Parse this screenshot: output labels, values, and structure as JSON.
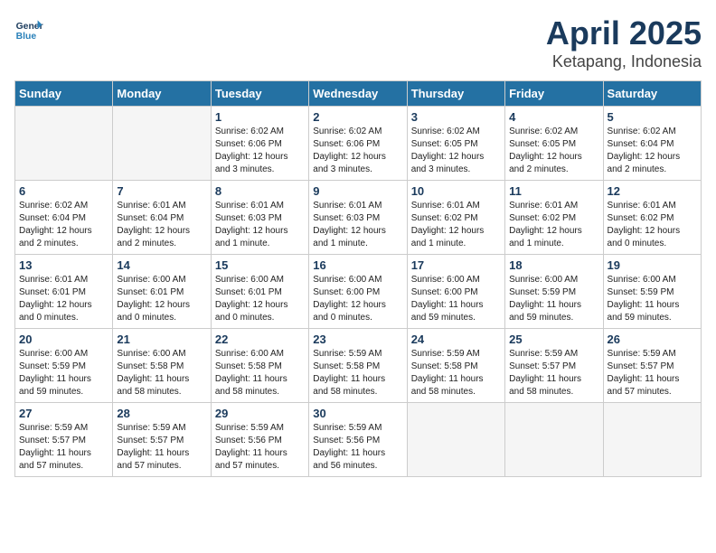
{
  "header": {
    "logo_line1": "General",
    "logo_line2": "Blue",
    "month": "April 2025",
    "location": "Ketapang, Indonesia"
  },
  "weekdays": [
    "Sunday",
    "Monday",
    "Tuesday",
    "Wednesday",
    "Thursday",
    "Friday",
    "Saturday"
  ],
  "weeks": [
    [
      {
        "day": "",
        "info": ""
      },
      {
        "day": "",
        "info": ""
      },
      {
        "day": "1",
        "info": "Sunrise: 6:02 AM\nSunset: 6:06 PM\nDaylight: 12 hours\nand 3 minutes."
      },
      {
        "day": "2",
        "info": "Sunrise: 6:02 AM\nSunset: 6:06 PM\nDaylight: 12 hours\nand 3 minutes."
      },
      {
        "day": "3",
        "info": "Sunrise: 6:02 AM\nSunset: 6:05 PM\nDaylight: 12 hours\nand 3 minutes."
      },
      {
        "day": "4",
        "info": "Sunrise: 6:02 AM\nSunset: 6:05 PM\nDaylight: 12 hours\nand 2 minutes."
      },
      {
        "day": "5",
        "info": "Sunrise: 6:02 AM\nSunset: 6:04 PM\nDaylight: 12 hours\nand 2 minutes."
      }
    ],
    [
      {
        "day": "6",
        "info": "Sunrise: 6:02 AM\nSunset: 6:04 PM\nDaylight: 12 hours\nand 2 minutes."
      },
      {
        "day": "7",
        "info": "Sunrise: 6:01 AM\nSunset: 6:04 PM\nDaylight: 12 hours\nand 2 minutes."
      },
      {
        "day": "8",
        "info": "Sunrise: 6:01 AM\nSunset: 6:03 PM\nDaylight: 12 hours\nand 1 minute."
      },
      {
        "day": "9",
        "info": "Sunrise: 6:01 AM\nSunset: 6:03 PM\nDaylight: 12 hours\nand 1 minute."
      },
      {
        "day": "10",
        "info": "Sunrise: 6:01 AM\nSunset: 6:02 PM\nDaylight: 12 hours\nand 1 minute."
      },
      {
        "day": "11",
        "info": "Sunrise: 6:01 AM\nSunset: 6:02 PM\nDaylight: 12 hours\nand 1 minute."
      },
      {
        "day": "12",
        "info": "Sunrise: 6:01 AM\nSunset: 6:02 PM\nDaylight: 12 hours\nand 0 minutes."
      }
    ],
    [
      {
        "day": "13",
        "info": "Sunrise: 6:01 AM\nSunset: 6:01 PM\nDaylight: 12 hours\nand 0 minutes."
      },
      {
        "day": "14",
        "info": "Sunrise: 6:00 AM\nSunset: 6:01 PM\nDaylight: 12 hours\nand 0 minutes."
      },
      {
        "day": "15",
        "info": "Sunrise: 6:00 AM\nSunset: 6:01 PM\nDaylight: 12 hours\nand 0 minutes."
      },
      {
        "day": "16",
        "info": "Sunrise: 6:00 AM\nSunset: 6:00 PM\nDaylight: 12 hours\nand 0 minutes."
      },
      {
        "day": "17",
        "info": "Sunrise: 6:00 AM\nSunset: 6:00 PM\nDaylight: 11 hours\nand 59 minutes."
      },
      {
        "day": "18",
        "info": "Sunrise: 6:00 AM\nSunset: 5:59 PM\nDaylight: 11 hours\nand 59 minutes."
      },
      {
        "day": "19",
        "info": "Sunrise: 6:00 AM\nSunset: 5:59 PM\nDaylight: 11 hours\nand 59 minutes."
      }
    ],
    [
      {
        "day": "20",
        "info": "Sunrise: 6:00 AM\nSunset: 5:59 PM\nDaylight: 11 hours\nand 59 minutes."
      },
      {
        "day": "21",
        "info": "Sunrise: 6:00 AM\nSunset: 5:58 PM\nDaylight: 11 hours\nand 58 minutes."
      },
      {
        "day": "22",
        "info": "Sunrise: 6:00 AM\nSunset: 5:58 PM\nDaylight: 11 hours\nand 58 minutes."
      },
      {
        "day": "23",
        "info": "Sunrise: 5:59 AM\nSunset: 5:58 PM\nDaylight: 11 hours\nand 58 minutes."
      },
      {
        "day": "24",
        "info": "Sunrise: 5:59 AM\nSunset: 5:58 PM\nDaylight: 11 hours\nand 58 minutes."
      },
      {
        "day": "25",
        "info": "Sunrise: 5:59 AM\nSunset: 5:57 PM\nDaylight: 11 hours\nand 58 minutes."
      },
      {
        "day": "26",
        "info": "Sunrise: 5:59 AM\nSunset: 5:57 PM\nDaylight: 11 hours\nand 57 minutes."
      }
    ],
    [
      {
        "day": "27",
        "info": "Sunrise: 5:59 AM\nSunset: 5:57 PM\nDaylight: 11 hours\nand 57 minutes."
      },
      {
        "day": "28",
        "info": "Sunrise: 5:59 AM\nSunset: 5:57 PM\nDaylight: 11 hours\nand 57 minutes."
      },
      {
        "day": "29",
        "info": "Sunrise: 5:59 AM\nSunset: 5:56 PM\nDaylight: 11 hours\nand 57 minutes."
      },
      {
        "day": "30",
        "info": "Sunrise: 5:59 AM\nSunset: 5:56 PM\nDaylight: 11 hours\nand 56 minutes."
      },
      {
        "day": "",
        "info": ""
      },
      {
        "day": "",
        "info": ""
      },
      {
        "day": "",
        "info": ""
      }
    ]
  ]
}
